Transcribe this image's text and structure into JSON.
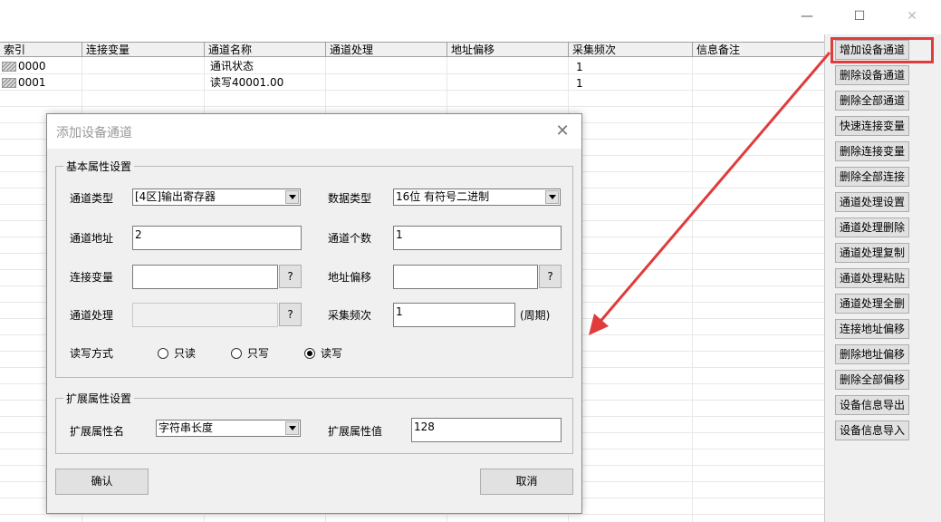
{
  "titlebar": {
    "minimize": "—",
    "maximize": "☐",
    "close": "✕"
  },
  "table": {
    "columns": [
      "索引",
      "连接变量",
      "通道名称",
      "通道处理",
      "地址偏移",
      "采集频次",
      "信息备注"
    ],
    "rows": [
      {
        "index": "0000",
        "var": "",
        "name": "通讯状态",
        "proc": "",
        "offset": "",
        "freq": "1",
        "note": ""
      },
      {
        "index": "0001",
        "var": "",
        "name": "读写40001.00",
        "proc": "",
        "offset": "",
        "freq": "1",
        "note": ""
      }
    ]
  },
  "side_buttons": [
    "增加设备通道",
    "删除设备通道",
    "删除全部通道",
    "快速连接变量",
    "删除连接变量",
    "删除全部连接",
    "通道处理设置",
    "通道处理删除",
    "通道处理复制",
    "通道处理粘贴",
    "通道处理全删",
    "连接地址偏移",
    "删除地址偏移",
    "删除全部偏移",
    "设备信息导出",
    "设备信息导入"
  ],
  "annotation_color": "#e03c3c",
  "dialog": {
    "title": "添加设备通道",
    "close": "✕",
    "basic_group": "基本属性设置",
    "channel_type_label": "通道类型",
    "channel_type_value": "[4区]输出寄存器",
    "data_type_label": "数据类型",
    "data_type_value": "16位 有符号二进制",
    "channel_addr_label": "通道地址",
    "channel_addr_value": "2",
    "channel_count_label": "通道个数",
    "channel_count_value": "1",
    "link_var_label": "连接变量",
    "link_var_value": "",
    "addr_offset_label": "地址偏移",
    "addr_offset_value": "",
    "channel_proc_label": "通道处理",
    "channel_proc_value": "",
    "freq_label": "采集频次",
    "freq_value": "1",
    "freq_unit": "(周期)",
    "question": "?",
    "rw_label": "读写方式",
    "rw_options": [
      "只读",
      "只写",
      "读写"
    ],
    "rw_selected": "读写",
    "ext_group": "扩展属性设置",
    "ext_name_label": "扩展属性名",
    "ext_name_value": "字符串长度",
    "ext_value_label": "扩展属性值",
    "ext_value_value": "128",
    "ok": "确认",
    "cancel": "取消"
  }
}
